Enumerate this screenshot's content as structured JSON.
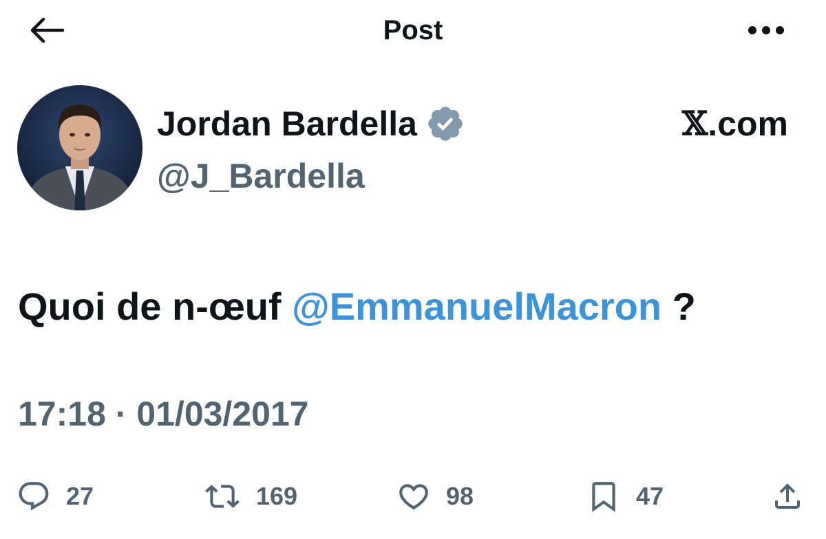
{
  "header": {
    "title": "Post",
    "back_icon": "arrow-left-icon",
    "more_icon": "more-horizontal-icon"
  },
  "author": {
    "display_name": "Jordan Bardella",
    "handle": "@J_Bardella",
    "verified_icon": "verified-badge-icon",
    "verified_color": "#829aab"
  },
  "source": {
    "logo": "𝕏",
    "suffix": ".com"
  },
  "tweet": {
    "text_before": "Quoi de n-œuf",
    "mention": "@EmmanuelMacron",
    "text_after": "?",
    "mention_color": "#3b94d9",
    "timestamp": "17:18 · 01/03/2017"
  },
  "actions": {
    "reply": {
      "icon": "reply-icon",
      "count": "27"
    },
    "retweet": {
      "icon": "retweet-icon",
      "count": "169"
    },
    "like": {
      "icon": "heart-icon",
      "count": "98"
    },
    "bookmark": {
      "icon": "bookmark-icon",
      "count": "47"
    },
    "share": {
      "icon": "share-icon"
    }
  },
  "colors": {
    "text": "#0f1419",
    "secondary": "#536471",
    "background": "#ffffff"
  }
}
